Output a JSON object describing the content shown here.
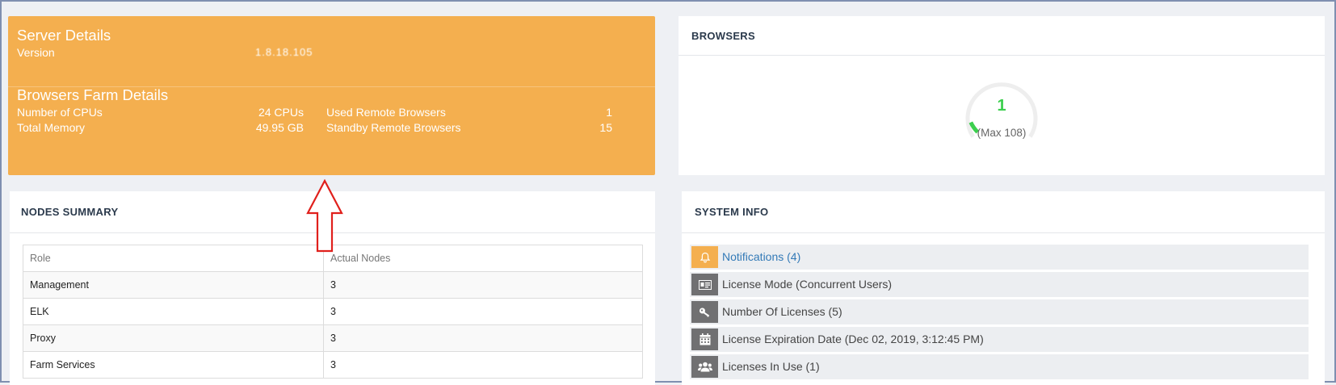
{
  "server": {
    "title": "Server Details",
    "version_label": "Version",
    "version_value": "1.8.18.105"
  },
  "farm": {
    "title": "Browsers Farm Details",
    "cpus_label": "Number of CPUs",
    "cpus_value": "24 CPUs",
    "memory_label": "Total Memory",
    "memory_value": "49.95 GB",
    "used_label": "Used Remote Browsers",
    "used_value": "1",
    "standby_label": "Standby Remote Browsers",
    "standby_value": "15"
  },
  "browsers": {
    "title": "BROWSERS",
    "count": "1",
    "max": "(Max 108)",
    "usage_fraction": 0.0093,
    "gauge_color": "#3ccf4e"
  },
  "nodes": {
    "title": "NODES SUMMARY",
    "headers": [
      "Role",
      "Actual Nodes"
    ],
    "rows": [
      [
        "Management",
        "3"
      ],
      [
        "ELK",
        "3"
      ],
      [
        "Proxy",
        "3"
      ],
      [
        "Farm Services",
        "3"
      ]
    ]
  },
  "system": {
    "title": "SYSTEM INFO",
    "items": [
      {
        "icon": "bell-icon",
        "label": "Notifications (4)"
      },
      {
        "icon": "id-card-icon",
        "label": "License Mode (Concurrent Users)"
      },
      {
        "icon": "key-icon",
        "label": "Number Of Licenses (5)"
      },
      {
        "icon": "calendar-icon",
        "label": "License Expiration Date (Dec 02, 2019, 3:12:45 PM)"
      },
      {
        "icon": "users-icon",
        "label": "Licenses In Use (1)"
      }
    ]
  },
  "colors": {
    "accent_orange": "#f4af4f",
    "link_blue": "#337ab7",
    "annotation_red": "#e0201c"
  }
}
